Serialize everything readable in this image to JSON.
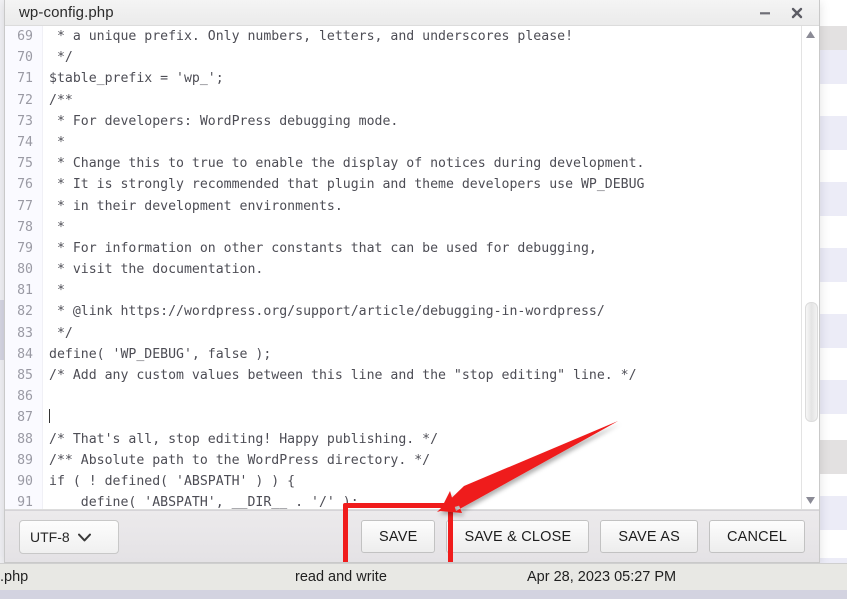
{
  "window": {
    "title": "wp-config.php",
    "minimize_label": "minimize",
    "close_label": "close"
  },
  "editor": {
    "first_line_number": 69,
    "lines": [
      {
        "n": "69",
        "text": " * a unique prefix. Only numbers, letters, and underscores please!"
      },
      {
        "n": "70",
        "text": " */"
      },
      {
        "n": "71",
        "text": "$table_prefix = 'wp_';"
      },
      {
        "n": "72",
        "text": "/**"
      },
      {
        "n": "73",
        "text": " * For developers: WordPress debugging mode."
      },
      {
        "n": "74",
        "text": " *"
      },
      {
        "n": "75",
        "text": " * Change this to true to enable the display of notices during development."
      },
      {
        "n": "76",
        "text": " * It is strongly recommended that plugin and theme developers use WP_DEBUG"
      },
      {
        "n": "77",
        "text": " * in their development environments."
      },
      {
        "n": "78",
        "text": " *"
      },
      {
        "n": "79",
        "text": " * For information on other constants that can be used for debugging,"
      },
      {
        "n": "80",
        "text": " * visit the documentation."
      },
      {
        "n": "81",
        "text": " *"
      },
      {
        "n": "82",
        "text": " * @link https://wordpress.org/support/article/debugging-in-wordpress/"
      },
      {
        "n": "83",
        "text": " */"
      },
      {
        "n": "84",
        "text": "define( 'WP_DEBUG', false );"
      },
      {
        "n": "85",
        "text": "/* Add any custom values between this line and the \"stop editing\" line. */"
      },
      {
        "n": "86",
        "text": ""
      },
      {
        "n": "87",
        "text": "",
        "caret": true
      },
      {
        "n": "88",
        "text": "/* That's all, stop editing! Happy publishing. */"
      },
      {
        "n": "89",
        "text": "/** Absolute path to the WordPress directory. */"
      },
      {
        "n": "90",
        "text": "if ( ! defined( 'ABSPATH' ) ) {"
      },
      {
        "n": "91",
        "text": "\tdefine( 'ABSPATH', __DIR__ . '/' );"
      }
    ]
  },
  "scrollbar": {
    "up_arrow": "scroll-up",
    "down_arrow": "scroll-down",
    "thumb_position_percent": 78
  },
  "toolbar": {
    "encoding": "UTF-8",
    "encoding_caret": "chevron-down-icon",
    "buttons": [
      {
        "label": "SAVE",
        "highlighted": true
      },
      {
        "label": "SAVE & CLOSE",
        "highlighted": false
      },
      {
        "label": "SAVE AS",
        "highlighted": false
      },
      {
        "label": "CANCEL",
        "highlighted": false
      }
    ]
  },
  "statusbar": {
    "filename": ".php",
    "permissions": "read and write",
    "modified": "Apr 28, 2023 05:27 PM"
  },
  "annotation": {
    "arrow_color": "#ef1c1c",
    "highlight_color": "#f01c1c",
    "points_to": "SAVE"
  }
}
